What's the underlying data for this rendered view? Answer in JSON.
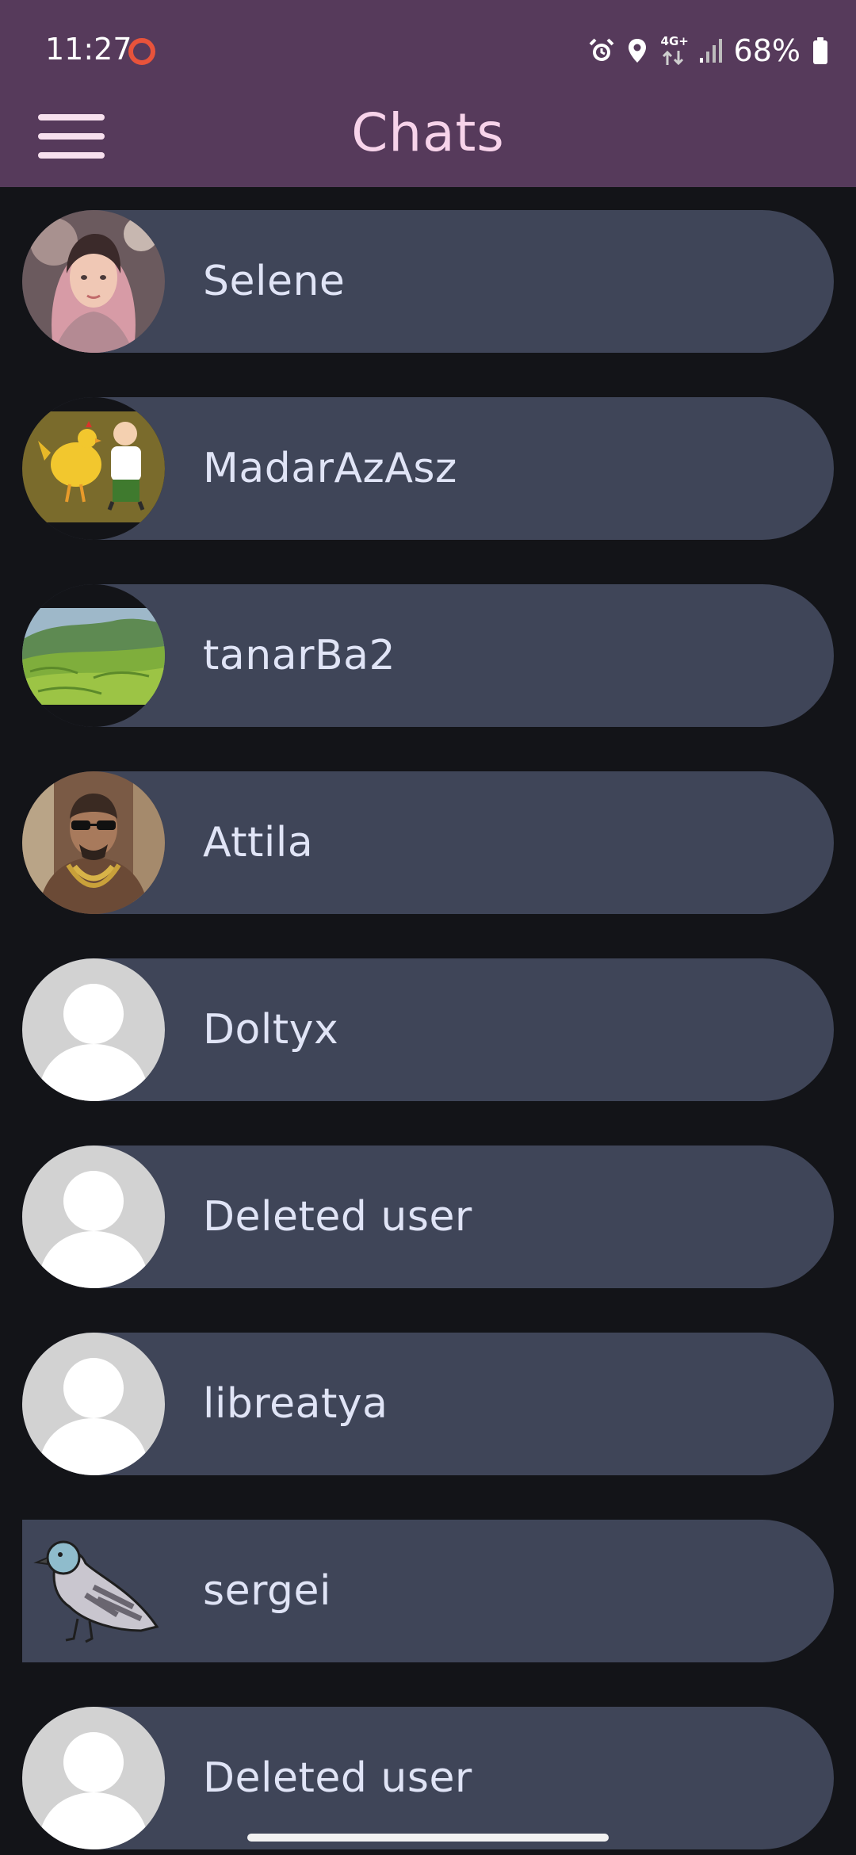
{
  "status_bar": {
    "time": "11:27",
    "network": "4G+",
    "battery": "68%"
  },
  "app_bar": {
    "title": "Chats"
  },
  "chats": [
    {
      "name": "Selene",
      "avatar": "woman-pink-hair-avatar"
    },
    {
      "name": "MadarAzAsz",
      "avatar": "cartoon-chicken-avatar"
    },
    {
      "name": "tanarBa2",
      "avatar": "tea-field-landscape-avatar"
    },
    {
      "name": "Attila",
      "avatar": "man-sunglasses-avatar"
    },
    {
      "name": "Doltyx",
      "avatar": "default-user-avatar"
    },
    {
      "name": "Deleted user",
      "avatar": "default-user-avatar"
    },
    {
      "name": "libreatya",
      "avatar": "default-user-avatar"
    },
    {
      "name": "sergei",
      "avatar": "pigeon-avatar"
    },
    {
      "name": "Deleted user",
      "avatar": "default-user-avatar"
    }
  ],
  "colors": {
    "header": "#563a5b",
    "title": "#f7d3ea",
    "background": "#131418",
    "chat_item": "#3f4558",
    "chat_text": "#e0e4f6"
  }
}
